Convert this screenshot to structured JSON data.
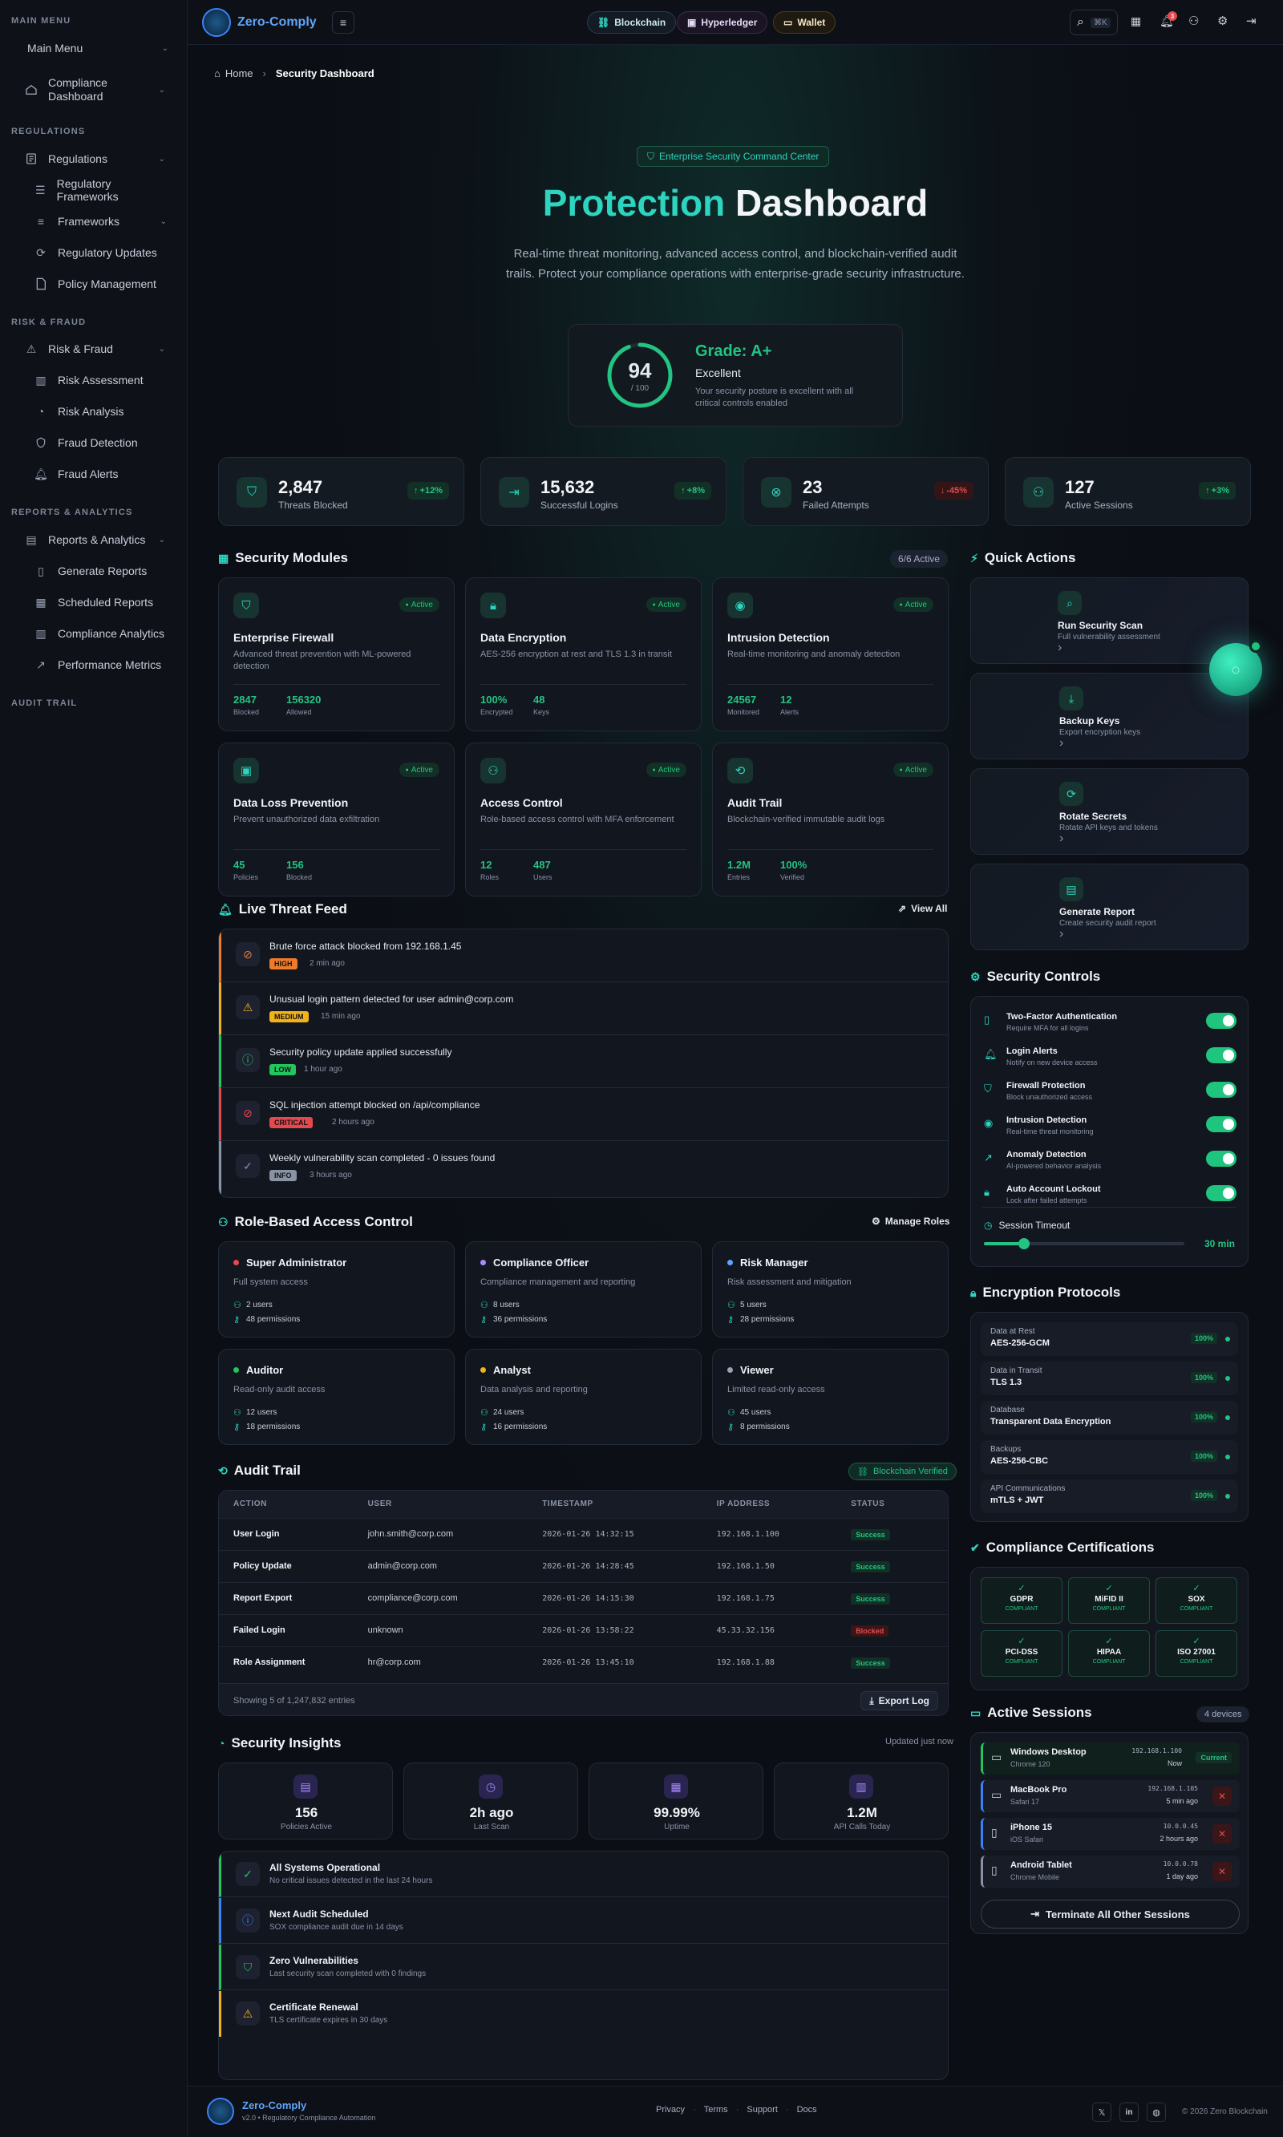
{
  "sidebar": {
    "main_section": "MAIN MENU",
    "main_menu": "Main Menu",
    "compliance_dashboard": "Compliance Dashboard",
    "reg_section": "REGULATIONS",
    "regulations": "Regulations",
    "reg_frameworks": "Regulatory Frameworks",
    "frameworks": "Frameworks",
    "reg_updates": "Regulatory Updates",
    "policy_mgmt": "Policy Management",
    "risk_section": "RISK & FRAUD",
    "risk_fraud": "Risk & Fraud",
    "risk_assessment": "Risk Assessment",
    "risk_analysis": "Risk Analysis",
    "fraud_detection": "Fraud Detection",
    "fraud_alerts": "Fraud Alerts",
    "reports_section": "REPORTS & ANALYTICS",
    "reports_analytics": "Reports & Analytics",
    "generate_reports": "Generate Reports",
    "scheduled_reports": "Scheduled Reports",
    "compliance_analytics": "Compliance Analytics",
    "performance_metrics": "Performance Metrics",
    "audit_section": "AUDIT TRAIL"
  },
  "topbar": {
    "brand": "Zero-Comply",
    "chips": [
      "Blockchain",
      "Hyperledger",
      "Wallet"
    ],
    "search_kbd": "⌘K",
    "notif_count": "3"
  },
  "breadcrumb": {
    "home": "Home",
    "current": "Security Dashboard"
  },
  "hero": {
    "badge": "Enterprise Security Command Center",
    "title_accent": "Protection",
    "title_rest": " Dashboard",
    "subtitle": "Real-time threat monitoring, advanced access control, and blockchain-verified audit trails. Protect your compliance operations with enterprise-grade security infrastructure.",
    "score": "94",
    "score_max": "/ 100",
    "score_fraction": 0.94,
    "grade": "Grade: A+",
    "grade_label": "Excellent",
    "grade_desc": "Your security posture is excellent with all critical controls enabled"
  },
  "stats": [
    {
      "value": "2,847",
      "label": "Threats Blocked",
      "trend": "+12%",
      "dir": "up",
      "icon": "shield-icon"
    },
    {
      "value": "15,632",
      "label": "Successful Logins",
      "trend": "+8%",
      "dir": "up",
      "icon": "login-icon"
    },
    {
      "value": "23",
      "label": "Failed Attempts",
      "trend": "-45%",
      "dir": "down",
      "icon": "x-circle-icon"
    },
    {
      "value": "127",
      "label": "Active Sessions",
      "trend": "+3%",
      "dir": "up",
      "icon": "users-icon"
    }
  ],
  "modules": {
    "title": "Security Modules",
    "count": "6/6 Active",
    "status": "Active",
    "items": [
      {
        "name": "Enterprise Firewall",
        "desc": "Advanced threat prevention with ML-powered detection",
        "m1v": "2847",
        "m1l": "Blocked",
        "m2v": "156320",
        "m2l": "Allowed",
        "icon": "shield-icon"
      },
      {
        "name": "Data Encryption",
        "desc": "AES-256 encryption at rest and TLS 1.3 in transit",
        "m1v": "100%",
        "m1l": "Encrypted",
        "m2v": "48",
        "m2l": "Keys",
        "icon": "lock-icon"
      },
      {
        "name": "Intrusion Detection",
        "desc": "Real-time monitoring and anomaly detection",
        "m1v": "24567",
        "m1l": "Monitored",
        "m2v": "12",
        "m2l": "Alerts",
        "icon": "eye-icon"
      },
      {
        "name": "Data Loss Prevention",
        "desc": "Prevent unauthorized data exfiltration",
        "m1v": "45",
        "m1l": "Policies",
        "m2v": "156",
        "m2l": "Blocked",
        "icon": "database-icon"
      },
      {
        "name": "Access Control",
        "desc": "Role-based access control with MFA enforcement",
        "m1v": "12",
        "m1l": "Roles",
        "m2v": "487",
        "m2l": "Users",
        "icon": "users-icon"
      },
      {
        "name": "Audit Trail",
        "desc": "Blockchain-verified immutable audit logs",
        "m1v": "1.2M",
        "m1l": "Entries",
        "m2v": "100%",
        "m2l": "Verified",
        "icon": "history-icon"
      }
    ]
  },
  "threats": {
    "title": "Live Threat Feed",
    "view_all": "View All",
    "items": [
      {
        "text": "Brute force attack blocked from 192.168.1.45",
        "sev": "HIGH",
        "time": "2 min ago",
        "color": "#f07a2a",
        "icon": "ban-icon"
      },
      {
        "text": "Unusual login pattern detected for user admin@corp.com",
        "sev": "MEDIUM",
        "time": "15 min ago",
        "color": "#f2b21b",
        "icon": "warning-icon"
      },
      {
        "text": "Security policy update applied successfully",
        "sev": "LOW",
        "time": "1 hour ago",
        "color": "#22c55e",
        "icon": "info-icon"
      },
      {
        "text": "SQL injection attempt blocked on /api/compliance",
        "sev": "CRITICAL",
        "time": "2 hours ago",
        "color": "#e5484d",
        "icon": "ban-icon"
      },
      {
        "text": "Weekly vulnerability scan completed - 0 issues found",
        "sev": "INFO",
        "time": "3 hours ago",
        "color": "#8a93a6",
        "icon": "check-circle-icon"
      }
    ]
  },
  "rbac": {
    "title": "Role-Based Access Control",
    "manage": "Manage Roles",
    "roles": [
      {
        "name": "Super Administrator",
        "desc": "Full system access",
        "users": "2 users",
        "perms": "48 permissions",
        "color": "#e5484d"
      },
      {
        "name": "Compliance Officer",
        "desc": "Compliance management and reporting",
        "users": "8 users",
        "perms": "36 permissions",
        "color": "#a78bfa"
      },
      {
        "name": "Risk Manager",
        "desc": "Risk assessment and mitigation",
        "users": "5 users",
        "perms": "28 permissions",
        "color": "#60a5fa"
      },
      {
        "name": "Auditor",
        "desc": "Read-only audit access",
        "users": "12 users",
        "perms": "18 permissions",
        "color": "#22c55e"
      },
      {
        "name": "Analyst",
        "desc": "Data analysis and reporting",
        "users": "24 users",
        "perms": "16 permissions",
        "color": "#f2b21b"
      },
      {
        "name": "Viewer",
        "desc": "Limited read-only access",
        "users": "45 users",
        "perms": "8 permissions",
        "color": "#9aa3b5"
      }
    ]
  },
  "audit": {
    "title": "Audit Trail",
    "verified": "Blockchain Verified",
    "headers": [
      "ACTION",
      "USER",
      "TIMESTAMP",
      "IP ADDRESS",
      "STATUS"
    ],
    "rows": [
      {
        "action": "User Login",
        "user": "john.smith@corp.com",
        "ts": "2026-01-26 14:32:15",
        "ip": "192.168.1.100",
        "status": "Success"
      },
      {
        "action": "Policy Update",
        "user": "admin@corp.com",
        "ts": "2026-01-26 14:28:45",
        "ip": "192.168.1.50",
        "status": "Success"
      },
      {
        "action": "Report Export",
        "user": "compliance@corp.com",
        "ts": "2026-01-26 14:15:30",
        "ip": "192.168.1.75",
        "status": "Success"
      },
      {
        "action": "Failed Login",
        "user": "unknown",
        "ts": "2026-01-26 13:58:22",
        "ip": "45.33.32.156",
        "status": "Blocked"
      },
      {
        "action": "Role Assignment",
        "user": "hr@corp.com",
        "ts": "2026-01-26 13:45:10",
        "ip": "192.168.1.88",
        "status": "Success"
      }
    ],
    "showing": "Showing 5 of 1,247,832 entries",
    "export": "Export Log"
  },
  "insights": {
    "title": "Security Insights",
    "updated": "Updated just now",
    "stats": [
      {
        "value": "156",
        "label": "Policies Active",
        "icon": "document-icon"
      },
      {
        "value": "2h ago",
        "label": "Last Scan",
        "icon": "clock-icon"
      },
      {
        "value": "99.99%",
        "label": "Uptime",
        "icon": "server-icon"
      },
      {
        "value": "1.2M",
        "label": "API Calls Today",
        "icon": "bar-chart-icon"
      }
    ],
    "items": [
      {
        "title": "All Systems Operational",
        "desc": "No critical issues detected in the last 24 hours",
        "color": "#22c55e",
        "icon": "check-circle-icon"
      },
      {
        "title": "Next Audit Scheduled",
        "desc": "SOX compliance audit due in 14 days",
        "color": "#3b82f6",
        "icon": "info-icon"
      },
      {
        "title": "Zero Vulnerabilities",
        "desc": "Last security scan completed with 0 findings",
        "color": "#22c55e",
        "icon": "shield-icon"
      },
      {
        "title": "Certificate Renewal",
        "desc": "TLS certificate expires in 30 days",
        "color": "#f2b21b",
        "icon": "warning-icon"
      }
    ]
  },
  "quick": {
    "title": "Quick Actions",
    "items": [
      {
        "title": "Run Security Scan",
        "desc": "Full vulnerability assessment",
        "icon": "search-icon"
      },
      {
        "title": "Backup Keys",
        "desc": "Export encryption keys",
        "icon": "download-icon"
      },
      {
        "title": "Rotate Secrets",
        "desc": "Rotate API keys and tokens",
        "icon": "refresh-icon"
      },
      {
        "title": "Generate Report",
        "desc": "Create security audit report",
        "icon": "document-icon"
      }
    ]
  },
  "controls": {
    "title": "Security Controls",
    "items": [
      {
        "title": "Two-Factor Authentication",
        "desc": "Require MFA for all logins",
        "icon": "phone-icon"
      },
      {
        "title": "Login Alerts",
        "desc": "Notify on new device access",
        "icon": "bell-icon"
      },
      {
        "title": "Firewall Protection",
        "desc": "Block unauthorized access",
        "icon": "shield-icon"
      },
      {
        "title": "Intrusion Detection",
        "desc": "Real-time threat monitoring",
        "icon": "eye-icon"
      },
      {
        "title": "Anomaly Detection",
        "desc": "AI-powered behavior analysis",
        "icon": "chart-icon"
      },
      {
        "title": "Auto Account Lockout",
        "desc": "Lock after failed attempts",
        "icon": "lock-icon"
      }
    ],
    "timeout_label": "Session Timeout",
    "timeout_value": "30 min",
    "timeout_fraction": 0.2
  },
  "encryption": {
    "title": "Encryption Protocols",
    "items": [
      {
        "label": "Data at Rest",
        "value": "AES-256-GCM",
        "pct": "100%"
      },
      {
        "label": "Data in Transit",
        "value": "TLS 1.3",
        "pct": "100%"
      },
      {
        "label": "Database",
        "value": "Transparent Data Encryption",
        "pct": "100%"
      },
      {
        "label": "Backups",
        "value": "AES-256-CBC",
        "pct": "100%"
      },
      {
        "label": "API Communications",
        "value": "mTLS + JWT",
        "pct": "100%"
      }
    ]
  },
  "certs": {
    "title": "Compliance Certifications",
    "status": "COMPLIANT",
    "items": [
      "GDPR",
      "MiFID II",
      "SOX",
      "PCI-DSS",
      "HIPAA",
      "ISO 27001"
    ]
  },
  "sessions": {
    "title": "Active Sessions",
    "count": "4 devices",
    "current": "Current",
    "items": [
      {
        "device": "Windows Desktop",
        "browser": "Chrome 120",
        "ip": "192.168.1.100",
        "time": "Now",
        "current": true,
        "color": "#22c55e",
        "icon": "desktop-icon"
      },
      {
        "device": "MacBook Pro",
        "browser": "Safari 17",
        "ip": "192.168.1.105",
        "time": "5 min ago",
        "current": false,
        "color": "#3b82f6",
        "icon": "laptop-icon"
      },
      {
        "device": "iPhone 15",
        "browser": "iOS Safari",
        "ip": "10.0.0.45",
        "time": "2 hours ago",
        "current": false,
        "color": "#3b82f6",
        "icon": "phone-icon"
      },
      {
        "device": "Android Tablet",
        "browser": "Chrome Mobile",
        "ip": "10.0.0.78",
        "time": "1 day ago",
        "current": false,
        "color": "#8a93a6",
        "icon": "tablet-icon"
      }
    ],
    "terminate": "Terminate All Other Sessions"
  },
  "footer": {
    "brand": "Zero-Comply",
    "tag": "v2.0 • Regulatory Compliance Automation",
    "links": [
      "Privacy",
      "Terms",
      "Support",
      "Docs"
    ],
    "copyright": "© 2026 Zero Blockchain"
  },
  "colors": {
    "accent": "#2dd4bf",
    "success": "#23c483",
    "danger": "#e5484d",
    "warning": "#f2b21b"
  }
}
